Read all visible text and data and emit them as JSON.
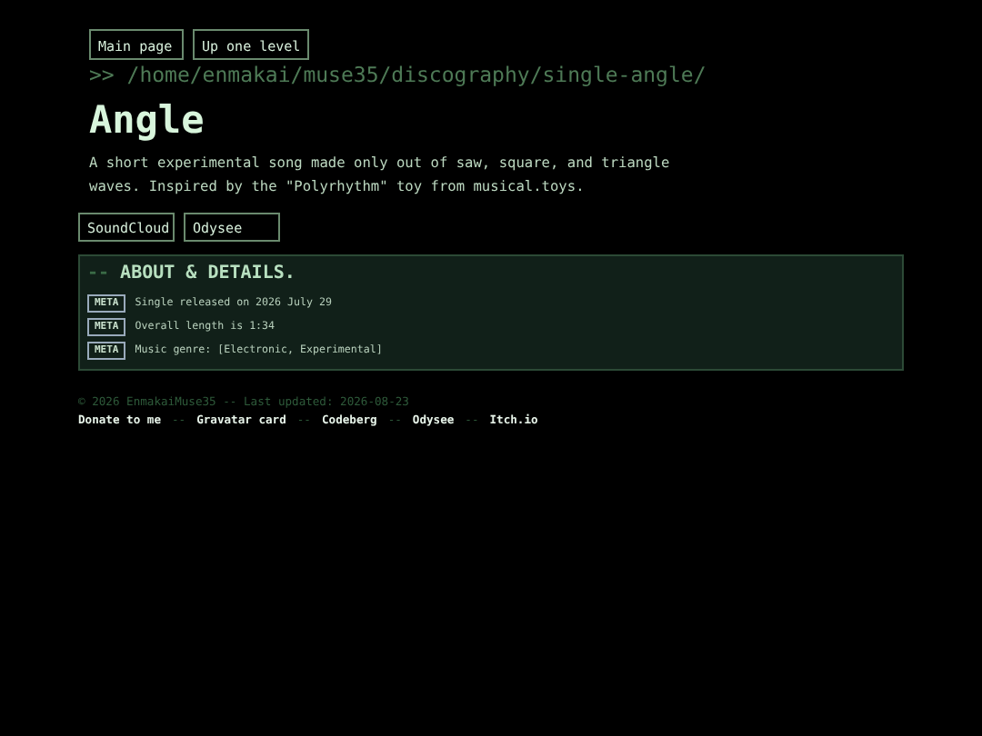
{
  "nav_buttons": [
    "Main page",
    "Up one level"
  ],
  "path": ">> /home/enmakai/muse35/discography/single-angle/",
  "title": "Angle",
  "description": "A short experimental song made only out of saw, square, and triangle waves. Inspired by the \"Polyrhythm\" toy from musical.toys.",
  "link_buttons": [
    "SoundCloud",
    "Odysee"
  ],
  "about": {
    "prefix": "--",
    "heading": "ABOUT & DETAILS.",
    "items": [
      {
        "tag": "META",
        "text": "Single released on 2026 July 29"
      },
      {
        "tag": "META",
        "text": "Overall length is 1:34"
      },
      {
        "tag": "META",
        "text": "Music genre: [Electronic, Experimental]"
      }
    ]
  },
  "footer": {
    "copyright": "© 2026 EnmakaiMuse35 -- Last updated: 2026-08-23",
    "separator": "--",
    "links": [
      "Donate to me",
      "Gravatar card",
      "Codeberg",
      "Odysee",
      "Itch.io"
    ]
  }
}
